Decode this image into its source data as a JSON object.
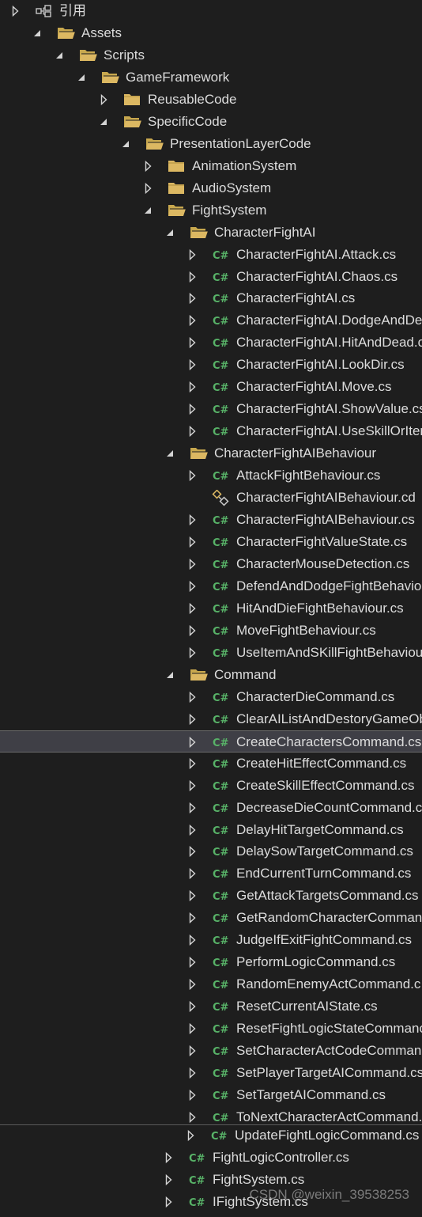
{
  "watermark": "CSDN @weixin_39538253",
  "tree": {
    "rows": [
      {
        "label": "引用",
        "icon": "references-icon",
        "expander": "collapsed"
      },
      {
        "label": "Assets",
        "icon": "folder-open-icon",
        "expander": "expanded"
      },
      {
        "label": "Scripts",
        "icon": "folder-open-icon",
        "expander": "expanded"
      },
      {
        "label": "GameFramework",
        "icon": "folder-open-icon",
        "expander": "expanded"
      },
      {
        "label": "ReusableCode",
        "icon": "folder-icon",
        "expander": "collapsed"
      },
      {
        "label": "SpecificCode",
        "icon": "folder-open-icon",
        "expander": "expanded"
      },
      {
        "label": "PresentationLayerCode",
        "icon": "folder-open-icon",
        "expander": "expanded"
      },
      {
        "label": "AnimationSystem",
        "icon": "folder-icon",
        "expander": "collapsed"
      },
      {
        "label": "AudioSystem",
        "icon": "folder-icon",
        "expander": "collapsed"
      },
      {
        "label": "FightSystem",
        "icon": "folder-open-icon",
        "expander": "expanded"
      },
      {
        "label": "CharacterFightAI",
        "icon": "folder-open-icon",
        "expander": "expanded"
      },
      {
        "label": "CharacterFightAI.Attack.cs",
        "icon": "csharp-file-icon",
        "expander": "collapsed"
      },
      {
        "label": "CharacterFightAI.Chaos.cs",
        "icon": "csharp-file-icon",
        "expander": "collapsed"
      },
      {
        "label": "CharacterFightAI.cs",
        "icon": "csharp-file-icon",
        "expander": "collapsed"
      },
      {
        "label": "CharacterFightAI.DodgeAndDe",
        "icon": "csharp-file-icon",
        "expander": "collapsed"
      },
      {
        "label": "CharacterFightAI.HitAndDead.c",
        "icon": "csharp-file-icon",
        "expander": "collapsed"
      },
      {
        "label": "CharacterFightAI.LookDir.cs",
        "icon": "csharp-file-icon",
        "expander": "collapsed"
      },
      {
        "label": "CharacterFightAI.Move.cs",
        "icon": "csharp-file-icon",
        "expander": "collapsed"
      },
      {
        "label": "CharacterFightAI.ShowValue.cs",
        "icon": "csharp-file-icon",
        "expander": "collapsed"
      },
      {
        "label": "CharacterFightAI.UseSkillOrIter",
        "icon": "csharp-file-icon",
        "expander": "collapsed"
      },
      {
        "label": "CharacterFightAIBehaviour",
        "icon": "folder-open-icon",
        "expander": "expanded"
      },
      {
        "label": "AttackFightBehaviour.cs",
        "icon": "csharp-file-icon",
        "expander": "collapsed"
      },
      {
        "label": "CharacterFightAIBehaviour.cd",
        "icon": "class-diagram-icon",
        "expander": "none"
      },
      {
        "label": "CharacterFightAIBehaviour.cs",
        "icon": "csharp-file-icon",
        "expander": "collapsed"
      },
      {
        "label": "CharacterFightValueState.cs",
        "icon": "csharp-file-icon",
        "expander": "collapsed"
      },
      {
        "label": "CharacterMouseDetection.cs",
        "icon": "csharp-file-icon",
        "expander": "collapsed"
      },
      {
        "label": "DefendAndDodgeFightBehavio",
        "icon": "csharp-file-icon",
        "expander": "collapsed"
      },
      {
        "label": "HitAndDieFightBehaviour.cs",
        "icon": "csharp-file-icon",
        "expander": "collapsed"
      },
      {
        "label": "MoveFightBehaviour.cs",
        "icon": "csharp-file-icon",
        "expander": "collapsed"
      },
      {
        "label": "UseItemAndSKillFightBehaviou",
        "icon": "csharp-file-icon",
        "expander": "collapsed"
      },
      {
        "label": "Command",
        "icon": "folder-open-icon",
        "expander": "expanded"
      },
      {
        "label": "CharacterDieCommand.cs",
        "icon": "csharp-file-icon",
        "expander": "collapsed"
      },
      {
        "label": "ClearAIListAndDestoryGameOb",
        "icon": "csharp-file-icon",
        "expander": "collapsed"
      },
      {
        "label": "CreateCharactersCommand.cs",
        "icon": "csharp-file-icon",
        "expander": "collapsed",
        "selected": true
      },
      {
        "label": "CreateHitEffectCommand.cs",
        "icon": "csharp-file-icon",
        "expander": "collapsed"
      },
      {
        "label": "CreateSkillEffectCommand.cs",
        "icon": "csharp-file-icon",
        "expander": "collapsed"
      },
      {
        "label": "DecreaseDieCountCommand.cs",
        "icon": "csharp-file-icon",
        "expander": "collapsed"
      },
      {
        "label": "DelayHitTargetCommand.cs",
        "icon": "csharp-file-icon",
        "expander": "collapsed"
      },
      {
        "label": "DelaySowTargetCommand.cs",
        "icon": "csharp-file-icon",
        "expander": "collapsed"
      },
      {
        "label": "EndCurrentTurnCommand.cs",
        "icon": "csharp-file-icon",
        "expander": "collapsed"
      },
      {
        "label": "GetAttackTargetsCommand.cs",
        "icon": "csharp-file-icon",
        "expander": "collapsed"
      },
      {
        "label": "GetRandomCharacterComman",
        "icon": "csharp-file-icon",
        "expander": "collapsed"
      },
      {
        "label": "JudgeIfExitFightCommand.cs",
        "icon": "csharp-file-icon",
        "expander": "collapsed"
      },
      {
        "label": "PerformLogicCommand.cs",
        "icon": "csharp-file-icon",
        "expander": "collapsed"
      },
      {
        "label": "RandomEnemyActCommand.c",
        "icon": "csharp-file-icon",
        "expander": "collapsed"
      },
      {
        "label": "ResetCurrentAIState.cs",
        "icon": "csharp-file-icon",
        "expander": "collapsed"
      },
      {
        "label": "ResetFightLogicStateCommanc",
        "icon": "csharp-file-icon",
        "expander": "collapsed"
      },
      {
        "label": "SetCharacterActCodeComman",
        "icon": "csharp-file-icon",
        "expander": "collapsed"
      },
      {
        "label": "SetPlayerTargetAICommand.cs",
        "icon": "csharp-file-icon",
        "expander": "collapsed"
      },
      {
        "label": "SetTargetAICommand.cs",
        "icon": "csharp-file-icon",
        "expander": "collapsed"
      },
      {
        "label": "ToNextCharacterActCommand.",
        "icon": "csharp-file-icon",
        "expander": "collapsed"
      },
      {
        "label": "UpdateFightLogicCommand.cs",
        "icon": "csharp-file-icon",
        "expander": "collapsed"
      },
      {
        "label": "FightLogicController.cs",
        "icon": "csharp-file-icon",
        "expander": "collapsed"
      },
      {
        "label": "FightSystem.cs",
        "icon": "csharp-file-icon",
        "expander": "collapsed"
      },
      {
        "label": "IFightSystem.cs",
        "icon": "csharp-file-icon",
        "expander": "collapsed"
      }
    ]
  }
}
